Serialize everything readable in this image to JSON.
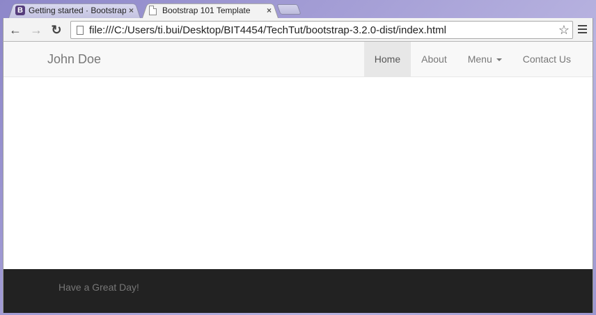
{
  "browser": {
    "tabs": [
      {
        "title": "Getting started · Bootstrap",
        "icon": "bootstrap-icon",
        "icon_letter": "B",
        "active": false
      },
      {
        "title": "Bootstrap 101 Template",
        "icon": "page-icon",
        "active": true
      }
    ],
    "close_glyph": "×",
    "address": "file:///C:/Users/ti.bui/Desktop/BIT4454/TechTut/bootstrap-3.2.0-dist/index.html",
    "back_glyph": "←",
    "forward_glyph": "→",
    "reload_glyph": "↻",
    "star_glyph": "☆"
  },
  "page": {
    "brand": "John Doe",
    "nav": [
      {
        "label": "Home",
        "active": true
      },
      {
        "label": "About",
        "active": false
      },
      {
        "label": "Menu",
        "active": false,
        "dropdown": true
      },
      {
        "label": "Contact Us",
        "active": false
      }
    ],
    "footer_text": "Have a Great Day!"
  },
  "colors": {
    "navbar_bg": "#f8f8f8",
    "footer_bg": "#222222",
    "muted_text": "#777777",
    "bootstrap_purple": "#563d7c"
  }
}
